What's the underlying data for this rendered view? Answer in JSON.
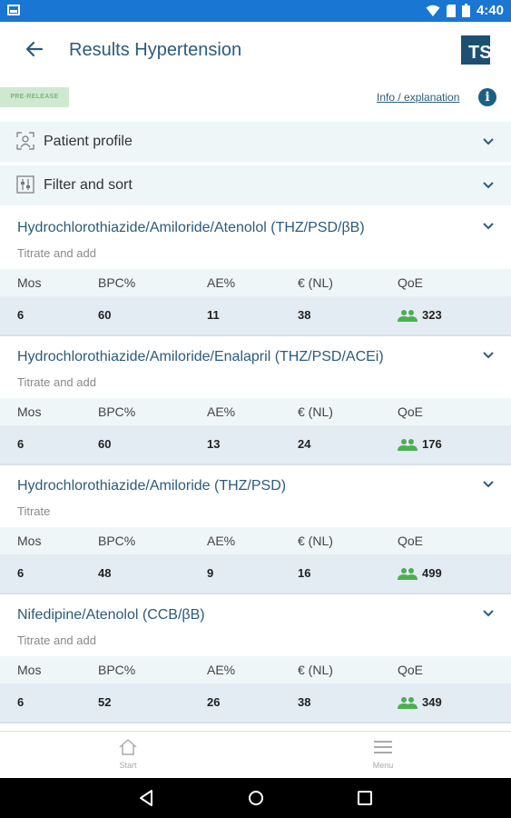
{
  "status_bar": {
    "time": "4:40",
    "icons": [
      "notification-icon",
      "wifi-icon",
      "sim-icon",
      "battery-icon"
    ]
  },
  "app_bar": {
    "title": "Results Hypertension",
    "logo_text": "TS"
  },
  "info_bar": {
    "badge": "PRE-RELEASE",
    "link": "Info / explanation"
  },
  "panels": {
    "profile": "Patient profile",
    "filter": "Filter and sort"
  },
  "columns": [
    "Mos",
    "BPC%",
    "AE%",
    "€ (NL)",
    "QoE"
  ],
  "results": [
    {
      "title": "Hydrochlorothiazide/Amiloride/Atenolol (THZ/PSD/βB)",
      "subtitle": "Titrate and add",
      "mos": "6",
      "bpc": "60",
      "ae": "11",
      "cost": "38",
      "qoe": "323"
    },
    {
      "title": "Hydrochlorothiazide/Amiloride/Enalapril (THZ/PSD/ACEi)",
      "subtitle": "Titrate and add",
      "mos": "6",
      "bpc": "60",
      "ae": "13",
      "cost": "24",
      "qoe": "176"
    },
    {
      "title": "Hydrochlorothiazide/Amiloride (THZ/PSD)",
      "subtitle": "Titrate",
      "mos": "6",
      "bpc": "48",
      "ae": "9",
      "cost": "16",
      "qoe": "499"
    },
    {
      "title": "Nifedipine/Atenolol (CCB/βB)",
      "subtitle": "Titrate and add",
      "mos": "6",
      "bpc": "52",
      "ae": "26",
      "cost": "38",
      "qoe": "349"
    }
  ],
  "bottom_nav": {
    "start": "Start",
    "menu": "Menu"
  },
  "colors": {
    "status_bar": "#1976d2",
    "accent": "#2b5b7e",
    "panel_bg": "#eef6f7",
    "value_row_bg": "#e3ecf3",
    "qoe_icon": "#4caf50"
  }
}
